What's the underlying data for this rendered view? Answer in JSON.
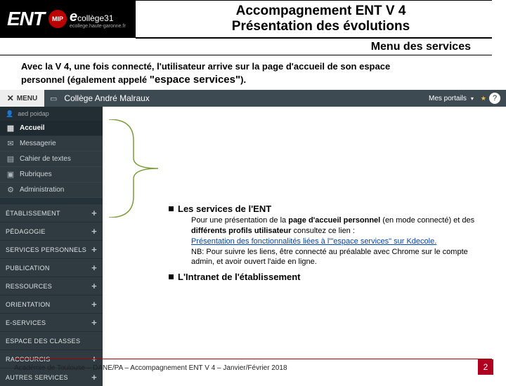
{
  "header": {
    "logo_text": "ENT",
    "mip": "MIP",
    "ecollege_e": "e",
    "ecollege_txt": "collège31",
    "ecollege_sub": "ecollege.haute-garonne.fr",
    "title1": "Accompagnement ENT V 4",
    "title2": "Présentation des évolutions"
  },
  "subtitle": "Menu des services",
  "intro": {
    "line1": "Avec la V 4, une fois connecté, l'utilisateur arrive sur la page d'accueil de son espace",
    "line2a": "personnel (également appelé ",
    "line2b": "\"espace services\"",
    "line2c": ")."
  },
  "mock": {
    "menu": "MENU",
    "college": "Collège André Malraux",
    "portails": "Mes portails",
    "user": "aed poidap",
    "help": "?"
  },
  "nav": {
    "home": "Accueil",
    "msg": "Messagerie",
    "cahier": "Cahier de textes",
    "rubriques": "Rubriques",
    "admin": "Administration"
  },
  "cats": {
    "c0": "ÉTABLISSEMENT",
    "c1": "PÉDAGOGIE",
    "c2": "SERVICES PERSONNELS",
    "c3": "PUBLICATION",
    "c4": "RESSOURCES",
    "c5": "ORIENTATION",
    "c6": "E-SERVICES",
    "c7": "ESPACE DES CLASSES",
    "c8": "RACCOURCIS",
    "c9": "AUTRES SERVICES"
  },
  "content": {
    "b1": "Les services de l'ENT",
    "s1a": "Pour une présentation de la ",
    "s1b": "page d'accueil personnel",
    "s1c": " (en mode connecté) et des ",
    "s1d": "différents profils utilisateur",
    "s1e": " consultez ce lien :",
    "link": "Présentation des fonctionnalités liées à l'\"espace services\" sur Kdecole.",
    "nb": "NB: Pour suivre les liens, être connecté au préalable avec Chrome sur le compte admin, et avoir ouvert l'aide en ligne.",
    "b2": "L'Intranet de l'établissement"
  },
  "footer": "Académie de Toulouse – DANE/PA – Accompagnement ENT V 4 – Janvier/Février 2018",
  "page": "2"
}
